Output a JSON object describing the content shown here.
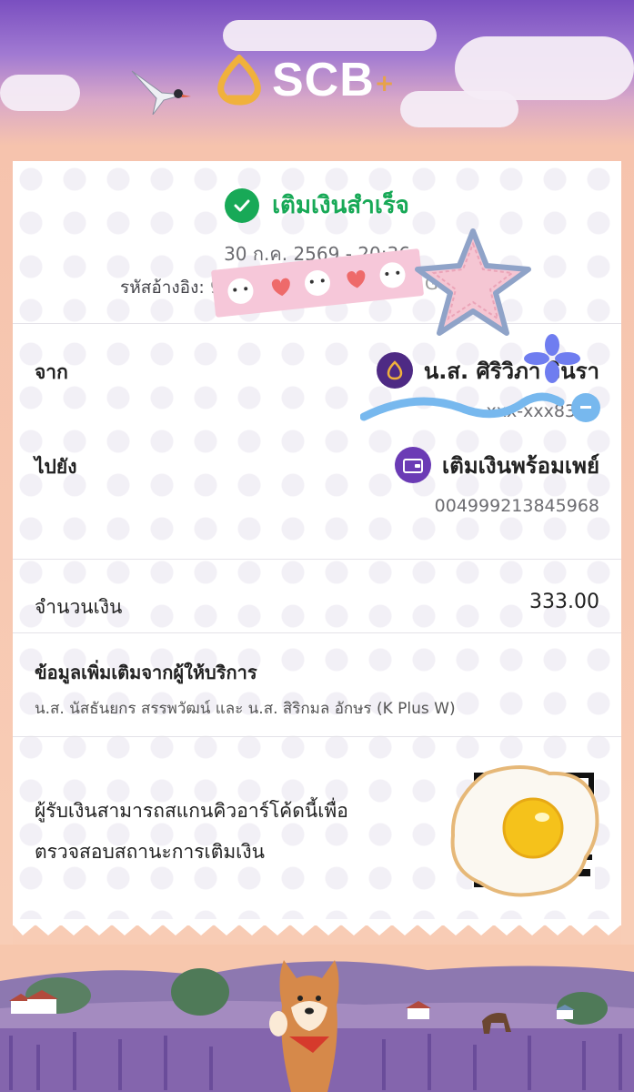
{
  "brand": {
    "name": "SCB",
    "plus_sign": "+"
  },
  "status": {
    "text": "เติมเงินสำเร็จ"
  },
  "datetime": "30 ก.ค. 2569 - 20:36",
  "reference": {
    "label": "รหัสอ้างอิง:",
    "value_visible": "990",
    "value_end": "GU"
  },
  "from": {
    "label": "จาก",
    "name": "น.ส. ศิริวิภา วินรา",
    "account": "xxx-xxx83"
  },
  "to": {
    "label": "ไปยัง",
    "name": "เติมเงินพร้อมเพย์",
    "account": "004999213845968"
  },
  "amount": {
    "label": "จำนวนเงิน",
    "value": "333.00"
  },
  "extra_info": {
    "title": "ข้อมูลเพิ่มเติมจากผู้ให้บริการ",
    "value": "น.ส. นัสธันยกร สรรพวัฒน์ และ น.ส. สิริกมล อักษร (K Plus W)"
  },
  "qr_note": {
    "line1": "ผู้รับเงินสามารถสแกนคิวอาร์โค้ดนี้เพื่อ",
    "line2": "ตรวจสอบสถานะการเติมเงิน"
  },
  "colors": {
    "success": "#18a957",
    "scb_purple": "#4e2a84",
    "scb_gold": "#e7a24a"
  }
}
